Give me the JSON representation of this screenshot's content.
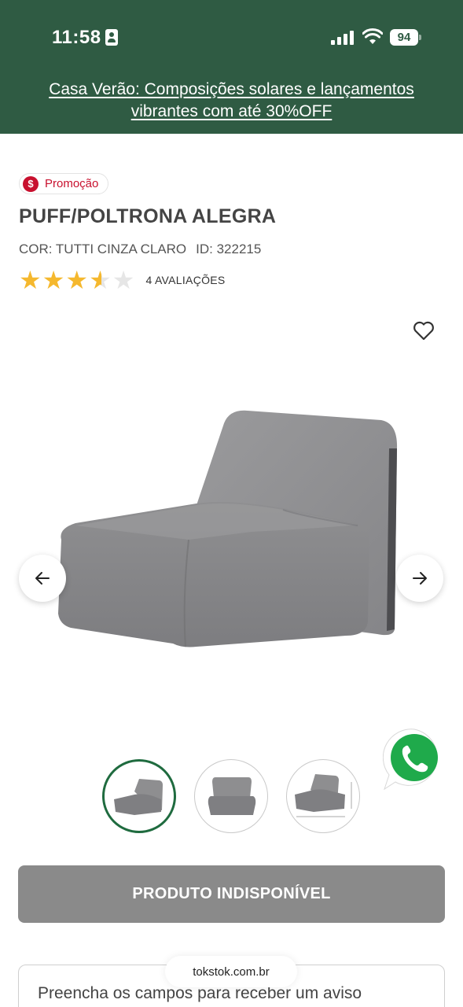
{
  "status_bar": {
    "time": "11:58",
    "battery": "94"
  },
  "banner": {
    "text": "Casa Verão: Composições solares e lançamentos vibrantes com até 30%OFF",
    "color": "#2f5b43"
  },
  "product": {
    "badge": "Promoção",
    "badge_icon": "dollar-icon",
    "name": "PUFF/POLTRONA ALEGRA",
    "color_label": "COR: TUTTI CINZA CLARO",
    "id_label": "ID: 322215",
    "rating": 3.5,
    "rating_max": 5,
    "reviews": "4 AVALIAÇÕES"
  },
  "gallery": {
    "thumbnails": [
      "front-angle-view",
      "front-view",
      "dimensions-view"
    ],
    "active_index": 0
  },
  "cta": {
    "label": "PRODUTO INDISPONÍVEL",
    "color": "#8a8a8a"
  },
  "notify": {
    "text": "Preencha os campos para receber um aviso"
  },
  "browser": {
    "url": "tokstok.com.br"
  }
}
